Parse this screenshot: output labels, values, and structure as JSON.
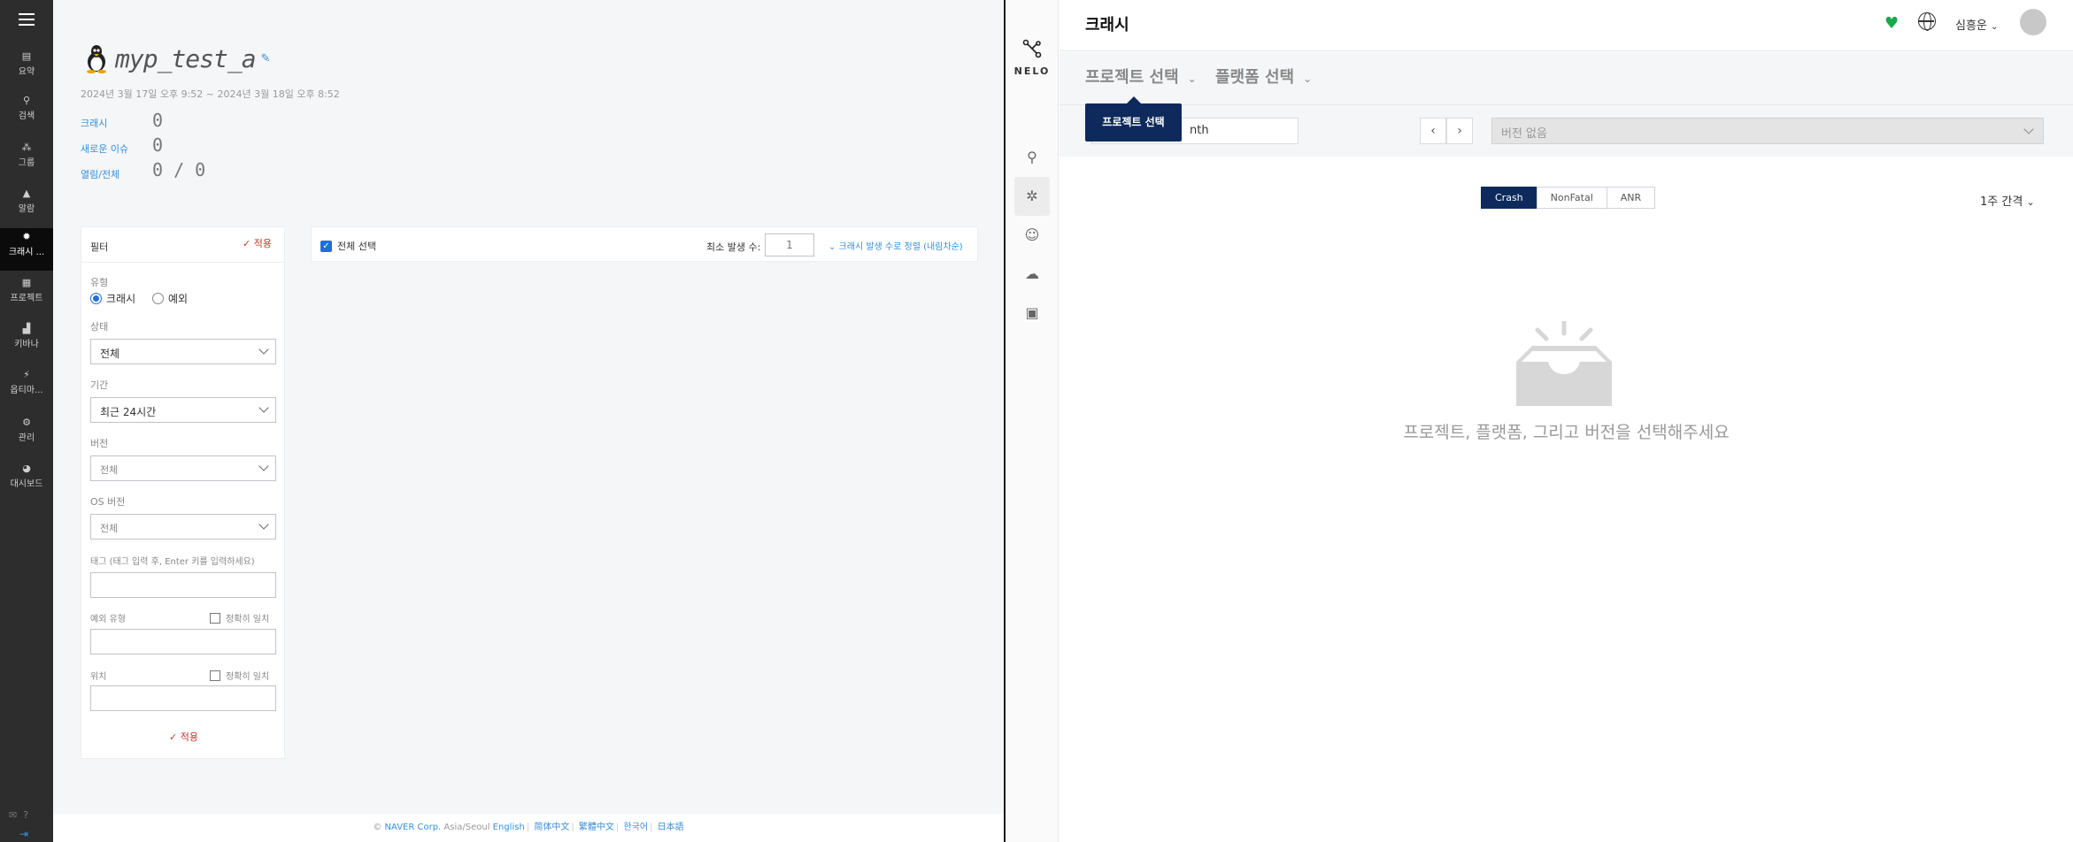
{
  "left": {
    "nav": {
      "items": [
        {
          "label": "요약",
          "icon": "summary-icon"
        },
        {
          "label": "검색",
          "icon": "search-icon"
        },
        {
          "label": "그룹",
          "icon": "group-icon"
        },
        {
          "label": "알람",
          "icon": "bell-icon"
        },
        {
          "label": "크래시 ...",
          "icon": "crash-icon"
        },
        {
          "label": "프로젝트",
          "icon": "project-icon"
        },
        {
          "label": "키바나",
          "icon": "kibana-icon"
        },
        {
          "label": "옵티마...",
          "icon": "bolt-icon"
        },
        {
          "label": "관리",
          "icon": "settings-icon"
        },
        {
          "label": "대시보드",
          "icon": "dashboard-icon"
        }
      ]
    },
    "app": {
      "name": "myp_test_a",
      "date_range": "2024년 3월 17일 오후 9:52 ~ 2024년 3월 18일 오후 8:52",
      "stats": [
        {
          "label": "크래시",
          "value": "0"
        },
        {
          "label": "새로운 이슈",
          "value": "0"
        },
        {
          "label": "열림/전체",
          "value": "0 / 0"
        }
      ]
    },
    "filter": {
      "title": "필터",
      "apply": "적용",
      "type_label": "유형",
      "type_options": [
        "크래시",
        "예외"
      ],
      "status_label": "상태",
      "status_value": "전체",
      "period_label": "기간",
      "period_value": "최근 24시간",
      "version_label": "버전",
      "version_value": "전체",
      "os_label": "OS 버전",
      "os_value": "전체",
      "tag_label": "태그 (태그 입력 후, Enter 키를 입력하세요)",
      "exception_label": "예외 유형",
      "exact_match": "정확히 일치",
      "location_label": "위치"
    },
    "list": {
      "select_all": "전체 선택",
      "min_label": "최소 발생 수:",
      "min_value": "1",
      "sort": "크래시 발생 수로 정렬 (내림차순)"
    },
    "footer": {
      "copyright": "© ",
      "corp": "NAVER Corp.",
      "tz": " Asia/Seoul ",
      "langs": [
        "English",
        "简体中文",
        "繁體中文",
        "한국어",
        "日本語"
      ]
    }
  },
  "right": {
    "brand": "NELO",
    "title": "크래시",
    "user": "심흥운",
    "project_select": "프로젝트 선택",
    "platform_select": "플랫폼 선택",
    "tooltip": "프로젝트 선택",
    "period_value": "nth",
    "version_placeholder": "버전 없음",
    "tabs": [
      "Crash",
      "NonFatal",
      "ANR"
    ],
    "interval": "1주 간격",
    "empty_message": "프로젝트, 플랫폼, 그리고 버전을 선택해주세요",
    "colors": {
      "accent": "#0e2a5c",
      "health": "#19a84a"
    }
  }
}
